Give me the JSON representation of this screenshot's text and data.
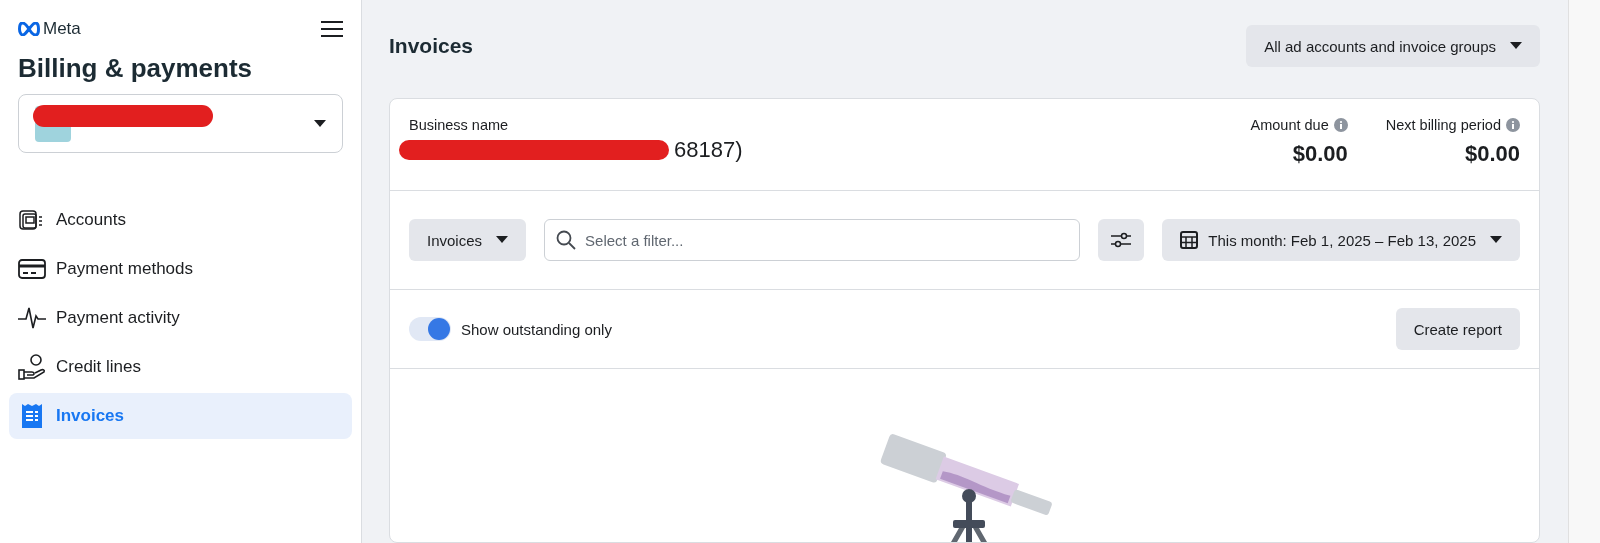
{
  "sidebar": {
    "brand": "Meta",
    "title": "Billing & payments",
    "account_selector": {
      "redacted": true
    },
    "items": [
      {
        "label": "Accounts",
        "kind": "accounts",
        "selected": false
      },
      {
        "label": "Payment methods",
        "kind": "card",
        "selected": false
      },
      {
        "label": "Payment activity",
        "kind": "pulse",
        "selected": false
      },
      {
        "label": "Credit lines",
        "kind": "credit",
        "selected": false
      },
      {
        "label": "Invoices",
        "kind": "invoice",
        "selected": true
      }
    ]
  },
  "header": {
    "title": "Invoices",
    "scope_dropdown": "All ad accounts and invoice groups"
  },
  "summary": {
    "business_label": "Business name",
    "business_value": "68187)",
    "business_redacted": true,
    "amounts": [
      {
        "label": "Amount due",
        "value": "$0.00"
      },
      {
        "label": "Next billing period",
        "value": "$0.00"
      }
    ]
  },
  "filters": {
    "type_dropdown": "Invoices",
    "search": {
      "placeholder": "Select a filter..."
    },
    "date_range": "This month: Feb 1, 2025 – Feb 13, 2025"
  },
  "options": {
    "toggle": {
      "label": "Show outstanding only",
      "on": true
    },
    "create_report": "Create report"
  }
}
